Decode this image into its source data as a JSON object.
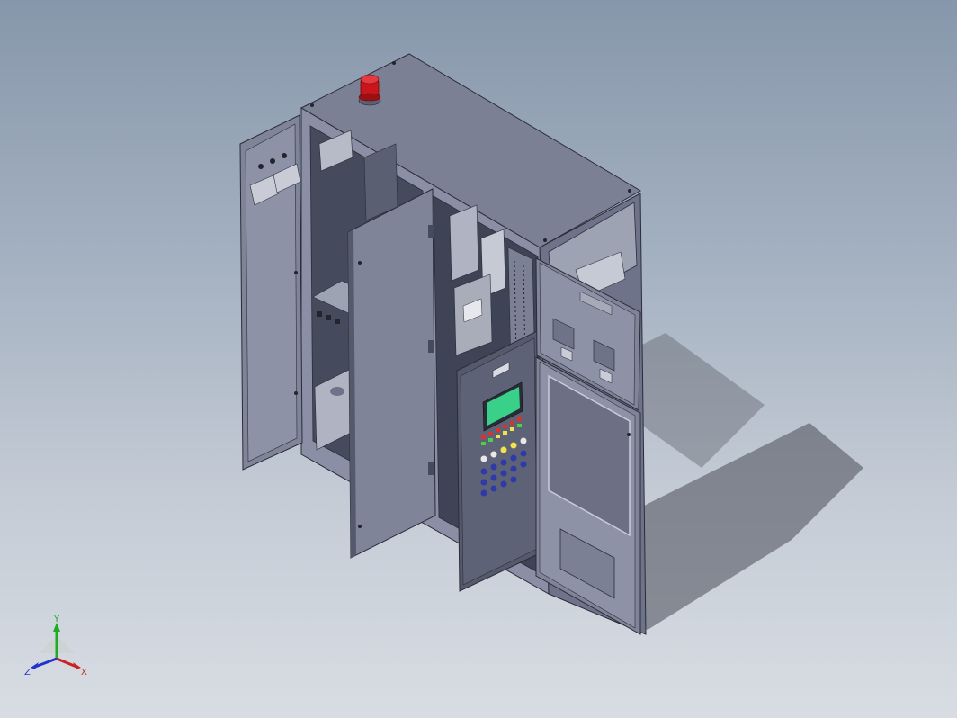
{
  "viewport": {
    "background_top": "#8797ab",
    "background_bottom": "#d8dde3"
  },
  "model": {
    "description_icon": "electrical-cabinet-assembly-icon",
    "colors": {
      "cabinet_body": "#8a8fa5",
      "cabinet_top": "#7c8095",
      "cabinet_side": "#6e7389",
      "door_face": "#7f8498",
      "door_dark": "#54596c",
      "interior": "#454a5c",
      "beacon": "#c8161c",
      "touch_screen": "#39d08a",
      "window_panel": "#6d7085",
      "shadow": "#4a4d57"
    }
  },
  "triad": {
    "x_label": "X",
    "y_label": "Y",
    "z_label": "Z",
    "x_color": "#cc2222",
    "y_color": "#22aa22",
    "z_color": "#2233cc"
  }
}
